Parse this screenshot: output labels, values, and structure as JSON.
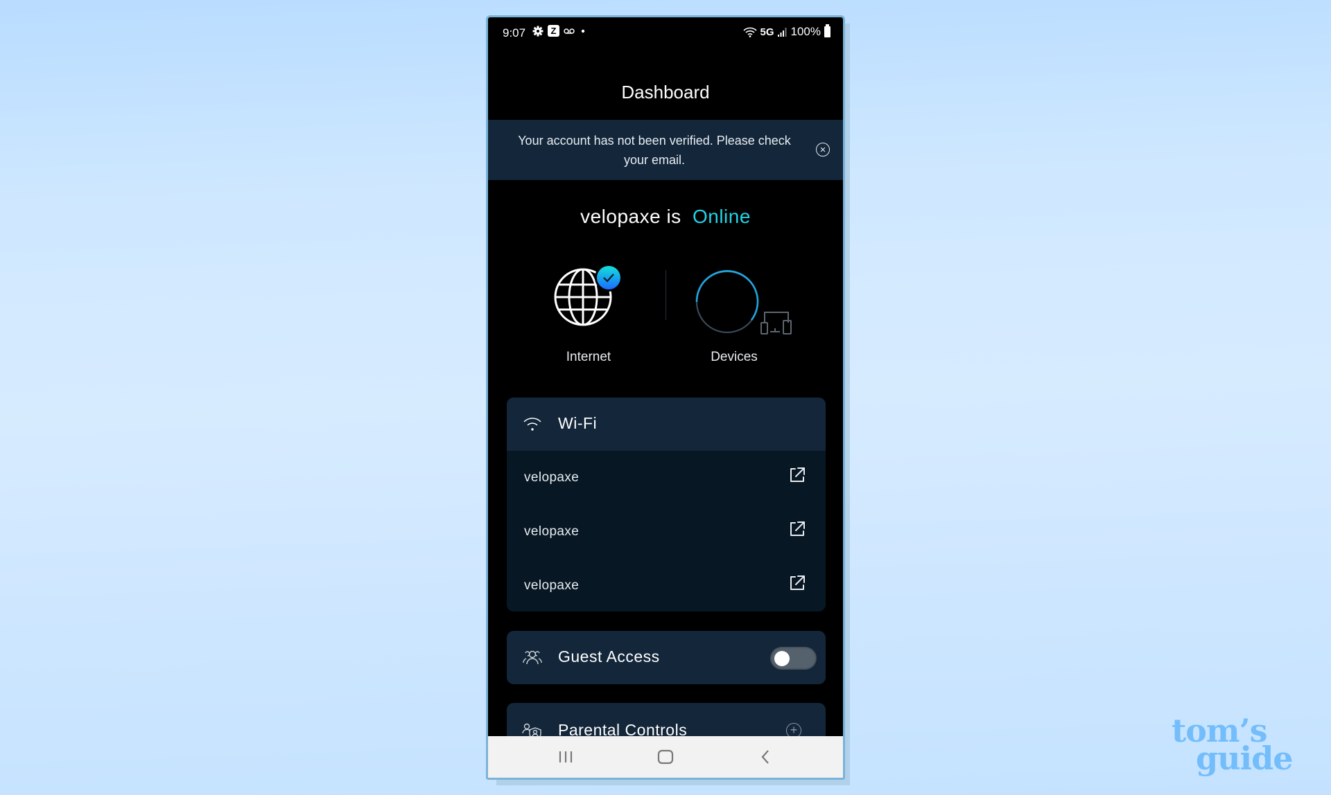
{
  "status_bar": {
    "time": "9:07",
    "left_icons": [
      "gear-icon",
      "app-notification-icon",
      "voicemail-icon",
      "dot-icon"
    ],
    "network": "5G",
    "battery": "100%"
  },
  "header": {
    "title": "Dashboard"
  },
  "banner": {
    "message": "Your account has not been verified. Please check your email.",
    "close_icon": "close-circle-icon"
  },
  "network_status": {
    "name": "velopaxe",
    "connector": "is",
    "state": "Online",
    "state_color": "#22d4e6"
  },
  "summary": {
    "internet": {
      "label": "Internet",
      "connected": true
    },
    "devices": {
      "label": "Devices"
    }
  },
  "wifi": {
    "title": "Wi-Fi",
    "networks": [
      {
        "ssid": "velopaxe"
      },
      {
        "ssid": "velopaxe"
      },
      {
        "ssid": "velopaxe"
      }
    ]
  },
  "guest_access": {
    "title": "Guest Access",
    "enabled": false
  },
  "parental_controls": {
    "title": "Parental Controls"
  },
  "nav_bar": {
    "recents": "recents-icon",
    "home": "home-icon",
    "back": "back-icon"
  },
  "watermark": {
    "line1": "tom’s",
    "line2": "guide"
  }
}
